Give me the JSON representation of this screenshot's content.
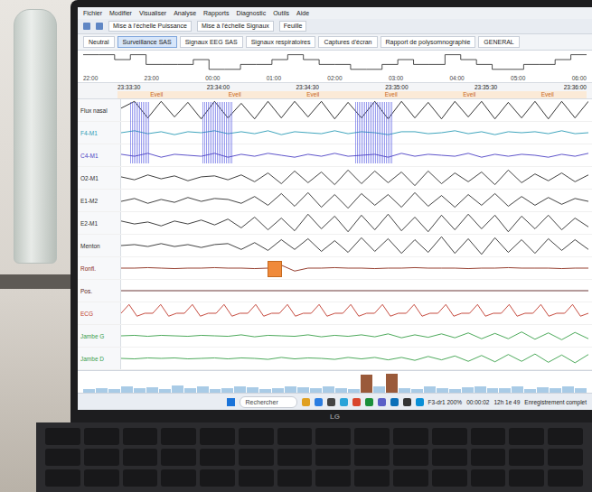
{
  "laptop": {
    "brand": "LG"
  },
  "menu": [
    "Fichier",
    "Modifier",
    "Visualiser",
    "Analyse",
    "Rapports",
    "Diagnostic",
    "Outils",
    "Aide"
  ],
  "toolbar": [
    "Mise à l'échelle Puissance",
    "Mise à l'échelle Signaux",
    "Feuille"
  ],
  "tabs": [
    {
      "label": "Neutral",
      "selected": false
    },
    {
      "label": "Surveillance SAS",
      "selected": true
    },
    {
      "label": "Signaux EEG SAS",
      "selected": false
    },
    {
      "label": "Signaux respiratoires",
      "selected": false
    },
    {
      "label": "Captures d'écran",
      "selected": false
    },
    {
      "label": "Rapport de polysomnographie",
      "selected": false
    },
    {
      "label": "GENERAL",
      "selected": false
    }
  ],
  "hypnogram": {
    "hours": [
      "22:00",
      "23:00",
      "00:00",
      "01:00",
      "02:00",
      "03:00",
      "04:00",
      "05:00",
      "06:00"
    ],
    "stages": [
      0,
      0,
      1,
      0,
      2,
      2,
      2,
      1,
      3,
      3,
      2,
      2,
      1,
      0,
      1,
      2,
      2,
      3,
      3,
      2,
      1,
      2,
      2,
      0,
      1,
      2,
      3,
      3,
      2,
      2,
      1,
      0
    ]
  },
  "ruler": {
    "span": 150,
    "times": [
      "23:33:30",
      "23:34:00",
      "23:34:30",
      "23:35:00",
      "23:35:30",
      "23:36:00"
    ],
    "epochs": [
      "Eveil",
      "Eveil",
      "Eveil",
      "Eveil",
      "Eveil",
      "Eveil"
    ]
  },
  "channels": [
    {
      "name": "Flux nasal",
      "color": "#1e1e1e",
      "marks": [],
      "values": [
        0.2,
        0.9,
        -0.8,
        0.9,
        -0.7,
        0.8,
        -0.9,
        0.9,
        -0.8,
        0.7,
        -0.9,
        0.9,
        -0.8,
        0.9,
        -0.7,
        0.9,
        -0.9,
        0.8,
        -0.8,
        0.9,
        -0.9,
        0.9,
        -0.8,
        0.8,
        -0.9,
        0.9,
        -0.7,
        0.9,
        -0.9,
        0.8,
        -0.8,
        0.9,
        -0.9,
        0.9,
        -0.8,
        0.9
      ]
    },
    {
      "name": "F4-M1",
      "color": "#2a9bb5",
      "marks": [
        {
          "kind": "burst",
          "start": 3,
          "end": 9,
          "color": "#4a4fe0"
        },
        {
          "kind": "burst",
          "start": 26,
          "end": 36,
          "color": "#4a4fe0"
        },
        {
          "kind": "burst",
          "start": 75,
          "end": 87,
          "color": "#4a4fe0"
        }
      ],
      "values": [
        0,
        0.2,
        -0.1,
        0.1,
        -0.2,
        0.1,
        0,
        0.2,
        -0.1,
        0.1,
        -0.1,
        0.2,
        -0.2,
        0.1,
        0,
        -0.1,
        0.2,
        -0.1,
        0.1,
        0,
        -0.2,
        0.1,
        0.1,
        -0.1,
        0,
        0.2,
        -0.1,
        0.1,
        -0.2,
        0.1,
        0,
        0.1,
        -0.1,
        0.2,
        -0.1,
        0
      ]
    },
    {
      "name": "C4-M1",
      "color": "#4b3fc4",
      "marks": [],
      "values": [
        0.1,
        -0.1,
        0.2,
        -0.2,
        0.1,
        0,
        -0.1,
        0.2,
        -0.2,
        0.1,
        -0.1,
        0.2,
        0,
        -0.2,
        0.1,
        -0.1,
        0.2,
        -0.1,
        0,
        0.1,
        -0.2,
        0.2,
        -0.1,
        0.1,
        0,
        -0.1,
        0.2,
        -0.2,
        0.1,
        -0.1,
        0.1,
        0,
        -0.2,
        0.1,
        -0.1,
        0.2
      ]
    },
    {
      "name": "O2-M1",
      "color": "#2c2c2c",
      "marks": [],
      "values": [
        0.1,
        -0.2,
        0.3,
        -0.1,
        0.2,
        -0.3,
        0.1,
        0.2,
        -0.2,
        0.3,
        -0.4,
        0.5,
        -0.6,
        0.7,
        -0.5,
        0.6,
        -0.7,
        0.8,
        -0.6,
        0.7,
        -0.5,
        0.6,
        -0.8,
        0.7,
        -0.6,
        0.5,
        -0.4,
        0.6,
        -0.7,
        0.8,
        -0.5,
        0.4,
        -0.3,
        0.5,
        -0.4,
        0.3
      ]
    },
    {
      "name": "E1-M2",
      "color": "#2c2c2c",
      "marks": [],
      "values": [
        -0.1,
        0.2,
        -0.3,
        0.1,
        -0.2,
        0.3,
        -0.1,
        0.2,
        0.1,
        -0.3,
        0.4,
        -0.5,
        0.7,
        -0.6,
        0.8,
        -0.7,
        0.6,
        -0.8,
        0.7,
        -0.5,
        0.6,
        -0.7,
        0.8,
        -0.6,
        0.5,
        -0.7,
        0.6,
        -0.5,
        0.7,
        -0.6,
        0.4,
        -0.5,
        0.3,
        -0.4,
        0.2,
        -0.1
      ]
    },
    {
      "name": "E2-M1",
      "color": "#2c2c2c",
      "marks": [],
      "values": [
        0.2,
        -0.1,
        0.1,
        -0.3,
        0.2,
        -0.1,
        0.3,
        -0.2,
        0.4,
        -0.5,
        0.6,
        -0.7,
        0.5,
        -0.8,
        0.9,
        -0.6,
        0.7,
        -0.9,
        0.8,
        -0.7,
        0.9,
        -0.8,
        0.6,
        -0.9,
        0.8,
        -0.7,
        0.9,
        -0.6,
        0.8,
        -0.9,
        0.7,
        -0.6,
        0.8,
        -0.7,
        0.5,
        -0.4
      ]
    },
    {
      "name": "Menton",
      "color": "#2c2c2c",
      "marks": [],
      "values": [
        0,
        0.1,
        -0.1,
        0.2,
        -0.1,
        0.1,
        -0.2,
        0.1,
        0.2,
        -0.4,
        0.3,
        -0.5,
        0.6,
        -0.4,
        0.7,
        -0.6,
        0.5,
        -0.7,
        0.8,
        -0.6,
        0.7,
        -0.8,
        0.6,
        -0.7,
        0.9,
        -0.8,
        0.7,
        -0.9,
        0.8,
        -0.7,
        0.6,
        -0.8,
        0.7,
        -0.5,
        0.6,
        -0.4
      ]
    },
    {
      "name": "Ronfl.",
      "color": "#8a2a1a",
      "marks": [
        {
          "kind": "marker",
          "start": 47,
          "end": 51,
          "color": "#f08a3a"
        }
      ],
      "values": [
        0,
        0,
        0.05,
        0,
        -0.05,
        0,
        0,
        0.05,
        0,
        0,
        -0.05,
        0,
        0.3,
        -0.3,
        0,
        0,
        0.05,
        0,
        0,
        -0.05,
        0,
        0,
        0.05,
        0,
        0,
        0,
        -0.05,
        0,
        0,
        0.05,
        0,
        0,
        0,
        -0.05,
        0,
        0
      ]
    },
    {
      "name": "Pos.",
      "color": "#5a2020",
      "marks": [],
      "values": [
        0,
        0,
        0,
        0,
        0,
        0,
        0,
        0,
        0,
        0,
        0,
        0
      ]
    },
    {
      "name": "ECG",
      "color": "#c0392b",
      "marks": [],
      "values": [
        0,
        0.9,
        -0.3,
        0,
        0,
        0.9,
        -0.3,
        0,
        0,
        0.9,
        -0.3,
        0,
        0,
        0.9,
        -0.3,
        0,
        0,
        0.9,
        -0.3,
        0,
        0,
        0.9,
        -0.3,
        0,
        0,
        0.9,
        -0.3,
        0,
        0,
        0.9,
        -0.3,
        0,
        0,
        0.9,
        -0.3,
        0,
        0,
        0.9,
        -0.3,
        0,
        0,
        0.9,
        -0.3,
        0,
        0,
        0.9,
        -0.3,
        0,
        0,
        0.9,
        -0.3,
        0,
        0,
        0.9,
        -0.3,
        0,
        0,
        0.9,
        -0.3,
        0
      ]
    },
    {
      "name": "Jambe G",
      "color": "#3aa04a",
      "marks": [],
      "values": [
        0,
        0.05,
        -0.05,
        0.05,
        0,
        -0.05,
        0.05,
        0,
        -0.05,
        0.1,
        -0.1,
        0.05,
        0,
        -0.05,
        0.1,
        -0.1,
        0.05,
        -0.05,
        0.1,
        -0.1,
        0.2,
        -0.2,
        0.1,
        -0.15,
        0.2,
        -0.2,
        0.3,
        -0.3,
        0.25,
        -0.3,
        0.4,
        -0.35,
        0.3,
        -0.4,
        0.35,
        -0.3
      ]
    },
    {
      "name": "Jambe D",
      "color": "#3aa04a",
      "marks": [],
      "values": [
        0,
        -0.05,
        0.05,
        0,
        0.05,
        -0.05,
        0,
        0.05,
        -0.05,
        0.05,
        0,
        -0.1,
        0.1,
        -0.05,
        0.05,
        0,
        -0.1,
        0.1,
        -0.05,
        0.1,
        -0.15,
        0.1,
        -0.2,
        0.2,
        -0.15,
        0.25,
        -0.3,
        0.3,
        -0.35,
        0.4,
        -0.3,
        0.45,
        -0.4,
        0.35,
        -0.45,
        0.4
      ]
    }
  ],
  "overview": {
    "values": [
      0.2,
      0.25,
      0.18,
      0.3,
      0.22,
      0.28,
      0.2,
      0.35,
      0.25,
      0.3,
      0.2,
      0.22,
      0.3,
      0.26,
      0.2,
      0.24,
      0.3,
      0.28,
      0.22,
      0.3,
      0.25,
      0.2,
      0.9,
      0.3,
      0.95,
      0.25,
      0.2,
      0.3,
      0.24,
      0.2,
      0.28,
      0.3,
      0.22,
      0.25,
      0.3,
      0.2,
      0.26,
      0.22,
      0.3,
      0.25
    ]
  },
  "taskbar": {
    "search": "Rechercher",
    "status": [
      "F3-dr1 200%",
      "00:00:02",
      "12h 1e 49",
      "Enregistrement complet"
    ]
  }
}
